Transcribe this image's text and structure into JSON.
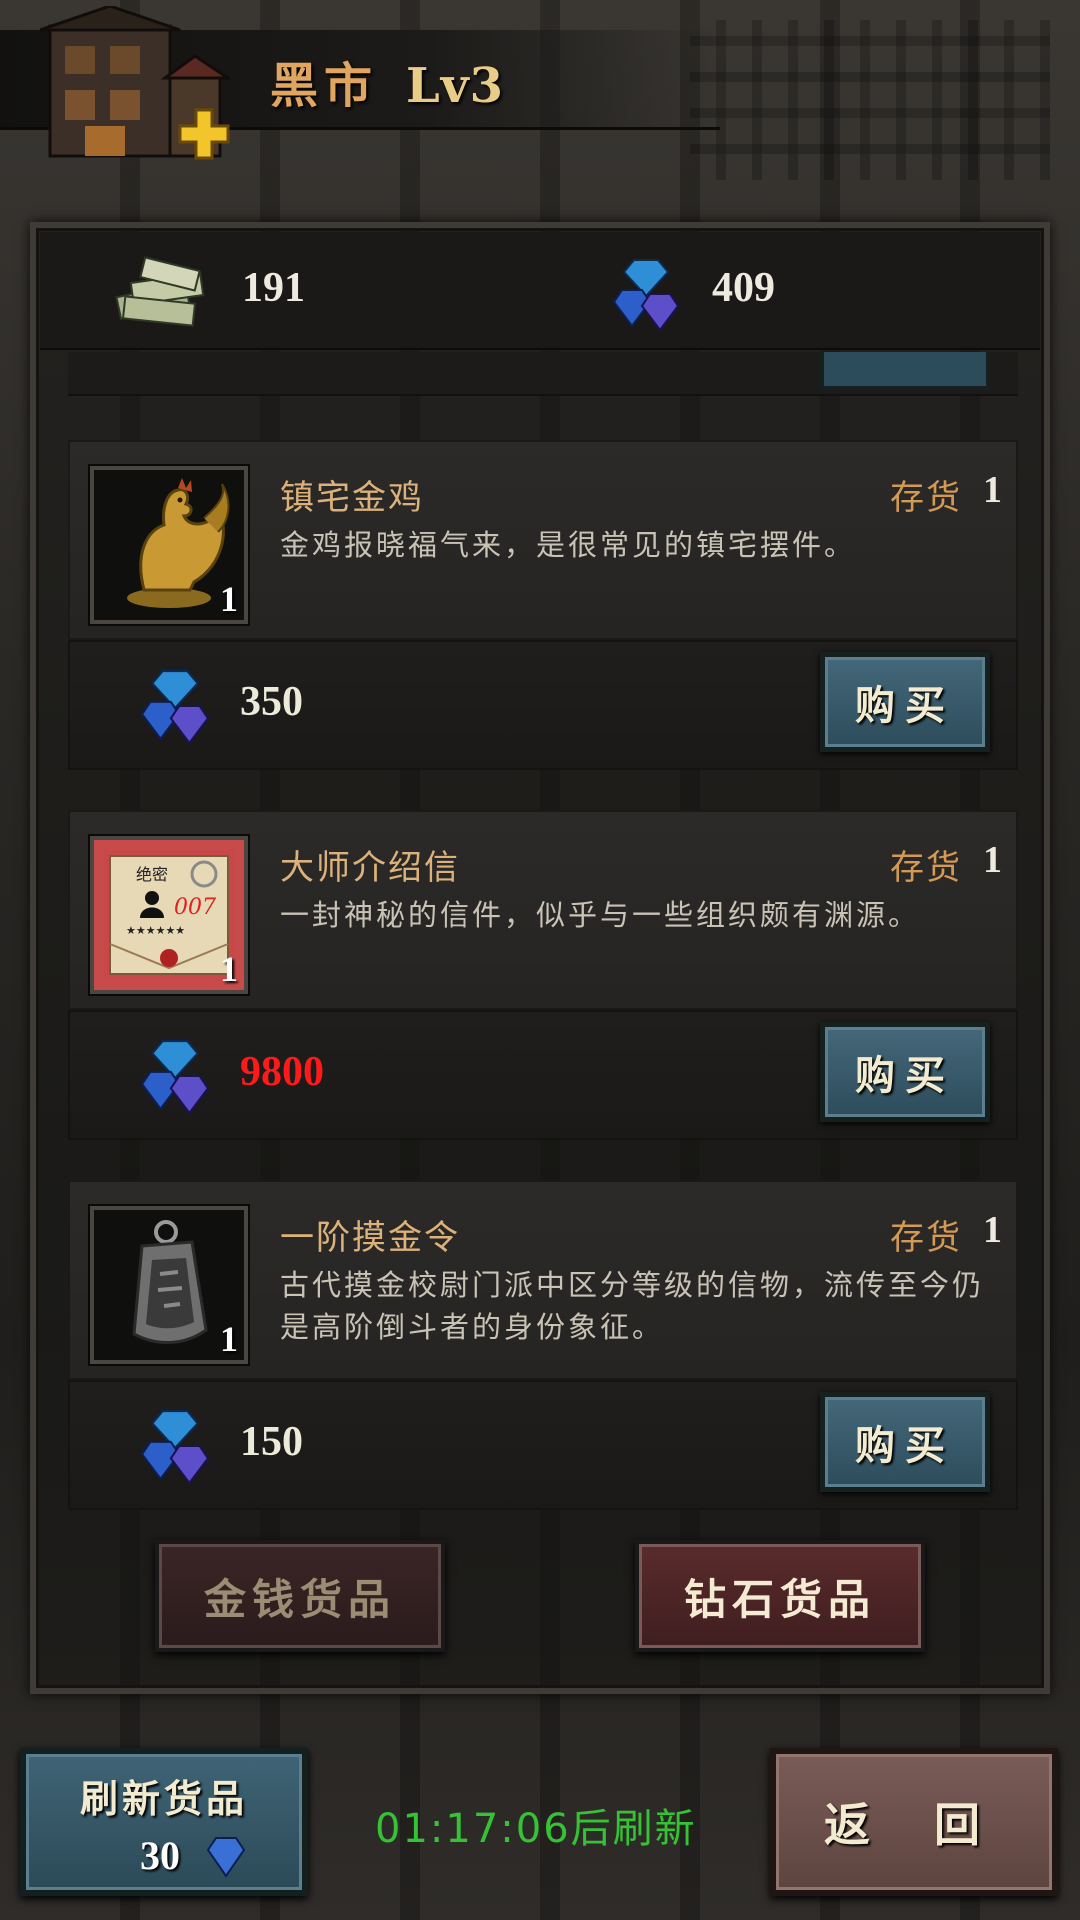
{
  "header": {
    "title": "黑市",
    "level": "Lv3"
  },
  "currency": {
    "money": "191",
    "diamonds": "409"
  },
  "items": [
    {
      "name": "镇宅金鸡",
      "stock_label": "存货",
      "stock": "1",
      "description": "金鸡报晓福气来，是很常见的镇宅摆件。",
      "quantity": "1",
      "price": "350",
      "price_insufficient": false,
      "buy_label": "购买",
      "icon": "golden-rooster-icon"
    },
    {
      "name": "大师介绍信",
      "stock_label": "存货",
      "stock": "1",
      "description": "一封神秘的信件，似乎与一些组织颇有渊源。",
      "quantity": "1",
      "price": "9800",
      "price_insufficient": true,
      "buy_label": "购买",
      "icon": "secret-letter-icon",
      "icon_text_top": "绝密",
      "icon_text_code": "007",
      "icon_text_stars": "★★★★★★"
    },
    {
      "name": "一阶摸金令",
      "stock_label": "存货",
      "stock": "1",
      "description": "古代摸金校尉门派中区分等级的信物，流传至今仍是高阶倒斗者的身份象征。",
      "quantity": "1",
      "price": "150",
      "price_insufficient": false,
      "buy_label": "购买",
      "icon": "iron-token-icon"
    }
  ],
  "tabs": {
    "money_goods": "金钱货品",
    "diamond_goods": "钻石货品"
  },
  "footer": {
    "refresh_label": "刷新货品",
    "refresh_cost": "30",
    "timer": "01:17:06后刷新",
    "back_label": "返 回"
  },
  "colors": {
    "accent_gold": "#dcb27a",
    "insufficient_red": "#ff1a1a",
    "timer_green": "#35c235",
    "button_teal": "#3f6475"
  }
}
